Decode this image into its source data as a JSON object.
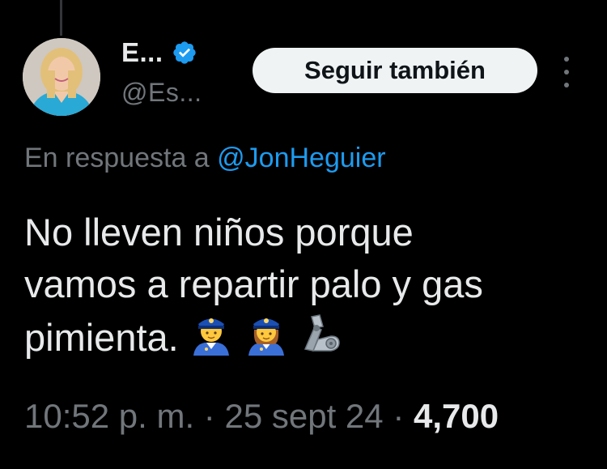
{
  "author": {
    "display_name": "E...",
    "handle": "@Es...",
    "verified": true,
    "avatar": "avatar-photo"
  },
  "actions": {
    "follow_label": "Seguir también",
    "more_icon": "more-vertical-icon"
  },
  "reply": {
    "prefix": "En respuesta a",
    "mention": "@JonHeguier"
  },
  "tweet": {
    "text_line_1": "No lleven niños porque",
    "text_line_2": "vamos a repartir palo y gas",
    "text_line_3": "pimienta.",
    "emojis": [
      "police-officer-emoji",
      "woman-police-officer-emoji",
      "flexed-mechanical-arm-emoji"
    ]
  },
  "meta": {
    "time": "10:52 p. m.",
    "separator": "·",
    "date": "25 sept 24",
    "views": "4,700"
  },
  "colors": {
    "background": "#000000",
    "text": "#e7e9ea",
    "muted": "#71767b",
    "link": "#1d9bf0",
    "verified": "#1d9bf0",
    "button_bg": "#eff3f4"
  }
}
